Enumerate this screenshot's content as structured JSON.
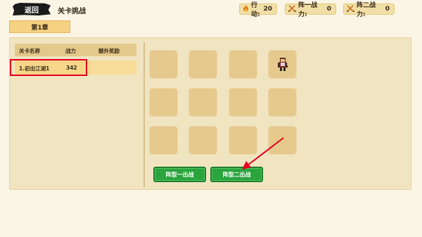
{
  "header": {
    "back_label": "返回",
    "title": "关卡挑战",
    "stats": [
      {
        "icon": "flame-icon",
        "label": "行动:",
        "value": "20"
      },
      {
        "icon": "crossed-swords-icon",
        "label": "阵一战力:",
        "value": "0"
      },
      {
        "icon": "crossed-swords-icon",
        "label": "阵二战力:",
        "value": "0"
      }
    ]
  },
  "chapter_tab": {
    "label": "第1章"
  },
  "level_list": {
    "columns": [
      "关卡名称",
      "战力",
      "额外奖励"
    ],
    "rows": [
      {
        "name": "1.初出江湖1",
        "power": "342",
        "reward": ""
      }
    ]
  },
  "formation_grid": {
    "rows": 3,
    "cols": 4,
    "occupied": [
      {
        "row": 0,
        "col": 3,
        "icon": "warrior-sprite-icon"
      }
    ]
  },
  "buttons": {
    "formation1": "阵型一出战",
    "formation2": "阵型二出战"
  },
  "colors": {
    "background": "#fbf5e6",
    "panel": "#f1e4c1",
    "accent_green": "#2aa43c",
    "highlight_red": "#e3001b"
  }
}
